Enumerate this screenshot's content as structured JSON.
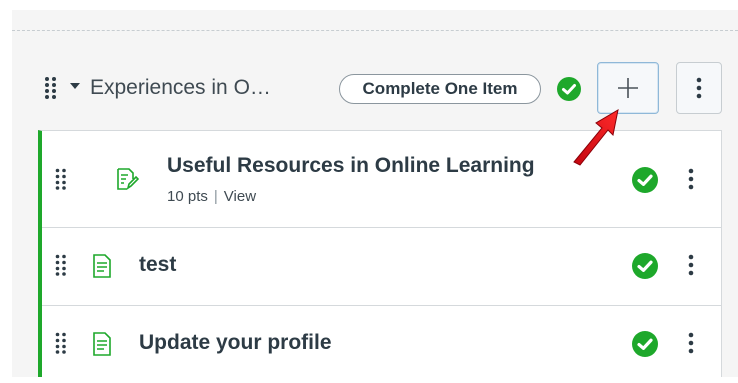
{
  "module": {
    "title": "Experiences in O…",
    "requirement_label": "Complete One Item",
    "add_label": "+"
  },
  "items": [
    {
      "title": "Useful Resources in Online Learning",
      "icon": "assignment-icon",
      "points": "10 pts",
      "link": "View",
      "status": "complete"
    },
    {
      "title": "test",
      "icon": "page-icon",
      "status": "complete"
    },
    {
      "title": "Update your profile",
      "icon": "page-icon",
      "status": "complete"
    }
  ],
  "colors": {
    "complete": "#1ea82b",
    "accent_border": "#1ea82b",
    "arrow": "#e8101a",
    "text": "#2d3b45"
  }
}
